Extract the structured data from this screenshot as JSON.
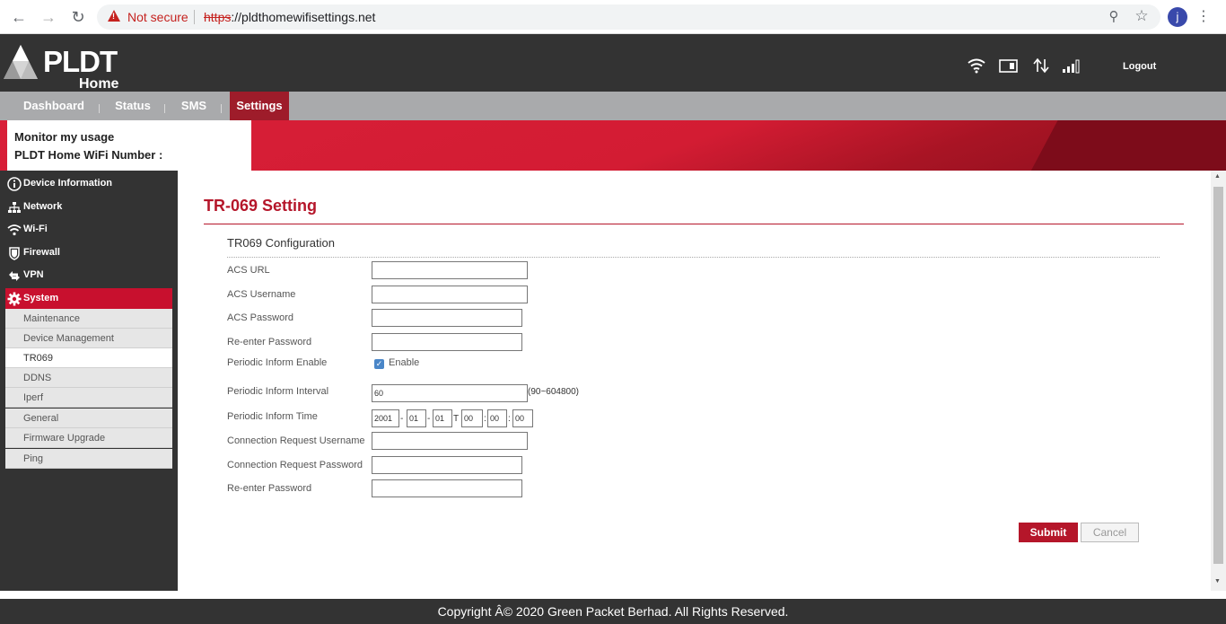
{
  "browser": {
    "not_secure": "Not secure",
    "url_scheme": "https",
    "url_rest": "://pldthomewifisettings.net",
    "avatar_letter": "j"
  },
  "header": {
    "logo_text": "PLDT",
    "logo_sub": "Home",
    "logout": "Logout"
  },
  "topnav": {
    "tabs": [
      {
        "label": "Dashboard"
      },
      {
        "label": "Status"
      },
      {
        "label": "SMS"
      },
      {
        "label": "Settings"
      }
    ],
    "active_tab": "Settings"
  },
  "banner": {
    "line1": "Monitor my usage",
    "line2": "PLDT Home WiFi Number :"
  },
  "sidebar": {
    "items": [
      {
        "label": "Device Information",
        "icon": "info-icon"
      },
      {
        "label": "Network",
        "icon": "network-icon"
      },
      {
        "label": "Wi-Fi",
        "icon": "wifi-icon"
      },
      {
        "label": "Firewall",
        "icon": "shield-icon"
      },
      {
        "label": "VPN",
        "icon": "vpn-icon"
      },
      {
        "label": "System",
        "icon": "gear-icon"
      }
    ],
    "subitems": [
      {
        "label": "Maintenance"
      },
      {
        "label": "Device Management"
      },
      {
        "label": "TR069"
      },
      {
        "label": "DDNS"
      },
      {
        "label": "Iperf"
      },
      {
        "label": "General"
      },
      {
        "label": "Firmware Upgrade"
      },
      {
        "label": "Ping"
      }
    ],
    "active_item": "System",
    "active_subitem": "TR069"
  },
  "main": {
    "title": "TR-069 Setting",
    "section": "TR069 Configuration",
    "fields": {
      "acs_url": {
        "label": "ACS URL",
        "value": ""
      },
      "acs_username": {
        "label": "ACS Username",
        "value": ""
      },
      "acs_password": {
        "label": "ACS Password",
        "value": ""
      },
      "reenter_password": {
        "label": "Re-enter Password",
        "value": ""
      },
      "periodic_enable": {
        "label": "Periodic Inform Enable",
        "option": "Enable",
        "checked": true
      },
      "periodic_interval": {
        "label": "Periodic Inform Interval",
        "value": "60",
        "hint": "(90~604800)"
      },
      "periodic_time": {
        "label": "Periodic Inform Time",
        "year": "2001",
        "month": "01",
        "day": "01",
        "t_sep": "T",
        "hour": "00",
        "minute": "00",
        "second": "00",
        "date_sep": "-",
        "time_sep": ":"
      },
      "conn_req_username": {
        "label": "Connection Request Username",
        "value": ""
      },
      "conn_req_password": {
        "label": "Connection Request Password",
        "value": ""
      },
      "conn_req_reenter": {
        "label": "Re-enter Password",
        "value": ""
      }
    },
    "submit": "Submit",
    "cancel": "Cancel"
  },
  "footer": {
    "text": "Copyright Â© 2020 Green Packet Berhad. All Rights Reserved."
  },
  "colors": {
    "accent": "#b5162a",
    "header_bg": "#333333",
    "nav_bg": "#a9aaac"
  }
}
